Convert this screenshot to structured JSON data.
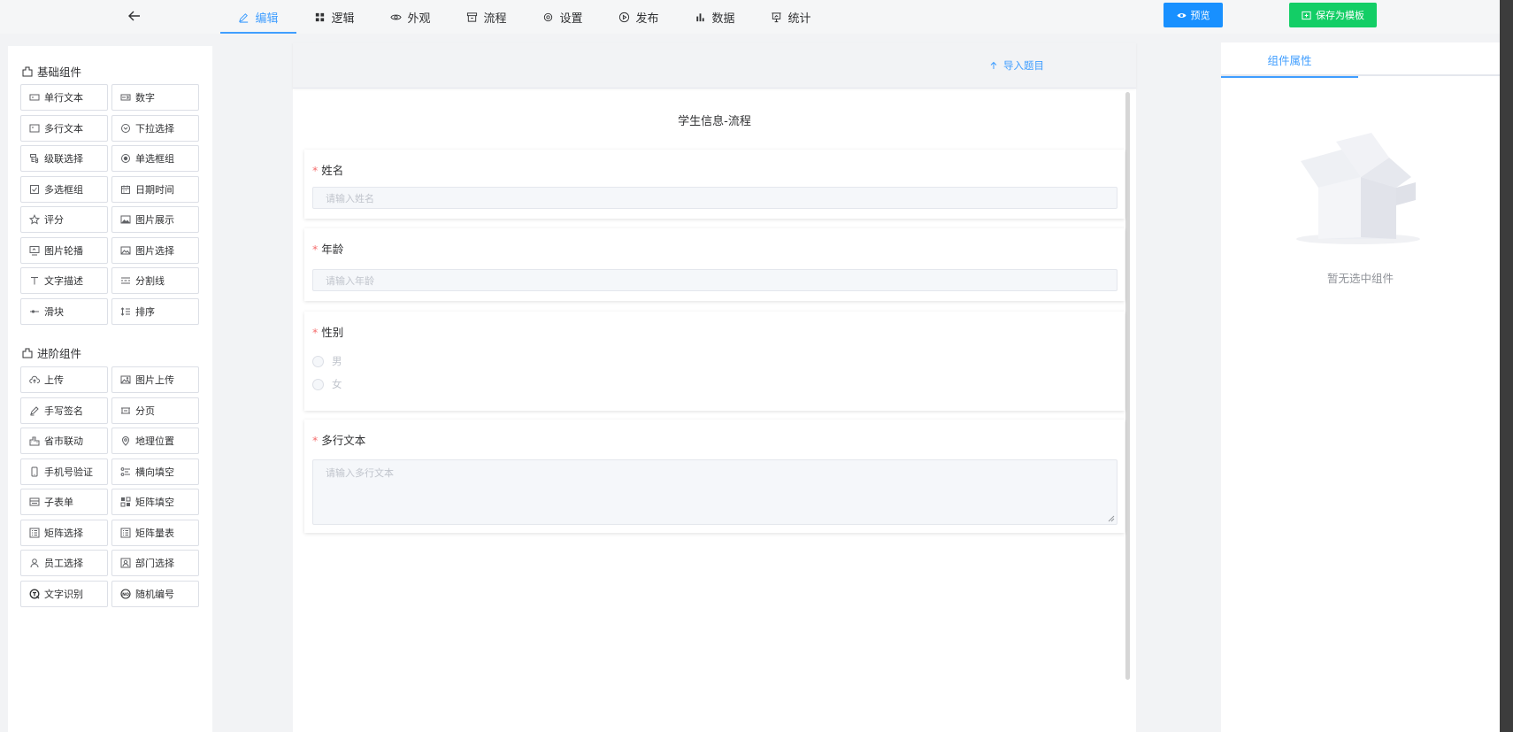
{
  "topbar": {
    "tabs": [
      {
        "label": "编辑",
        "icon": "edit-icon",
        "active": true
      },
      {
        "label": "逻辑",
        "icon": "grid-icon",
        "active": false
      },
      {
        "label": "外观",
        "icon": "eye-icon",
        "active": false
      },
      {
        "label": "流程",
        "icon": "archive-icon",
        "active": false
      },
      {
        "label": "设置",
        "icon": "gear-icon",
        "active": false
      },
      {
        "label": "发布",
        "icon": "play-circle-icon",
        "active": false
      },
      {
        "label": "数据",
        "icon": "bar-chart-icon",
        "active": false
      },
      {
        "label": "统计",
        "icon": "presentation-icon",
        "active": false
      }
    ],
    "preview_label": "预览",
    "save_template_label": "保存为模板",
    "accent_color": "#409eff",
    "preview_color": "#1890ff",
    "save_color": "#13ce66"
  },
  "left_panel": {
    "basic_title": "基础组件",
    "basic_items": [
      {
        "label": "单行文本",
        "icon": "single-line-text-icon"
      },
      {
        "label": "数字",
        "icon": "number-icon"
      },
      {
        "label": "多行文本",
        "icon": "multi-line-text-icon"
      },
      {
        "label": "下拉选择",
        "icon": "dropdown-icon"
      },
      {
        "label": "级联选择",
        "icon": "cascader-icon"
      },
      {
        "label": "单选框组",
        "icon": "radio-icon"
      },
      {
        "label": "多选框组",
        "icon": "checkbox-icon"
      },
      {
        "label": "日期时间",
        "icon": "calendar-icon"
      },
      {
        "label": "评分",
        "icon": "star-icon"
      },
      {
        "label": "图片展示",
        "icon": "image-icon"
      },
      {
        "label": "图片轮播",
        "icon": "carousel-icon"
      },
      {
        "label": "图片选择",
        "icon": "image-select-icon"
      },
      {
        "label": "文字描述",
        "icon": "text-icon"
      },
      {
        "label": "分割线",
        "icon": "divider-icon"
      },
      {
        "label": "滑块",
        "icon": "slider-icon"
      },
      {
        "label": "排序",
        "icon": "sort-icon"
      }
    ],
    "advanced_title": "进阶组件",
    "advanced_items": [
      {
        "label": "上传",
        "icon": "upload-cloud-icon"
      },
      {
        "label": "图片上传",
        "icon": "image-upload-icon"
      },
      {
        "label": "手写签名",
        "icon": "pen-icon"
      },
      {
        "label": "分页",
        "icon": "pagination-icon"
      },
      {
        "label": "省市联动",
        "icon": "city-icon"
      },
      {
        "label": "地理位置",
        "icon": "location-icon"
      },
      {
        "label": "手机号验证",
        "icon": "phone-icon"
      },
      {
        "label": "横向填空",
        "icon": "horizontal-fill-icon"
      },
      {
        "label": "子表单",
        "icon": "subform-icon"
      },
      {
        "label": "矩阵填空",
        "icon": "matrix-fill-icon"
      },
      {
        "label": "矩阵选择",
        "icon": "matrix-select-icon"
      },
      {
        "label": "矩阵量表",
        "icon": "matrix-scale-icon"
      },
      {
        "label": "员工选择",
        "icon": "user-icon"
      },
      {
        "label": "部门选择",
        "icon": "department-icon"
      },
      {
        "label": "文字识别",
        "icon": "ocr-icon"
      },
      {
        "label": "随机编号",
        "icon": "random-number-icon"
      }
    ]
  },
  "canvas": {
    "import_label": "导入题目",
    "form_title": "学生信息-流程",
    "questions": {
      "name": {
        "label": "姓名",
        "placeholder": "请输入姓名"
      },
      "age": {
        "label": "年龄",
        "placeholder": "请输入年龄"
      },
      "gender": {
        "label": "性别",
        "options": [
          "男",
          "女"
        ]
      },
      "multiline": {
        "label": "多行文本",
        "placeholder": "请输入多行文本"
      }
    }
  },
  "right_panel": {
    "tab_label": "组件属性",
    "empty_text": "暂无选中组件"
  }
}
